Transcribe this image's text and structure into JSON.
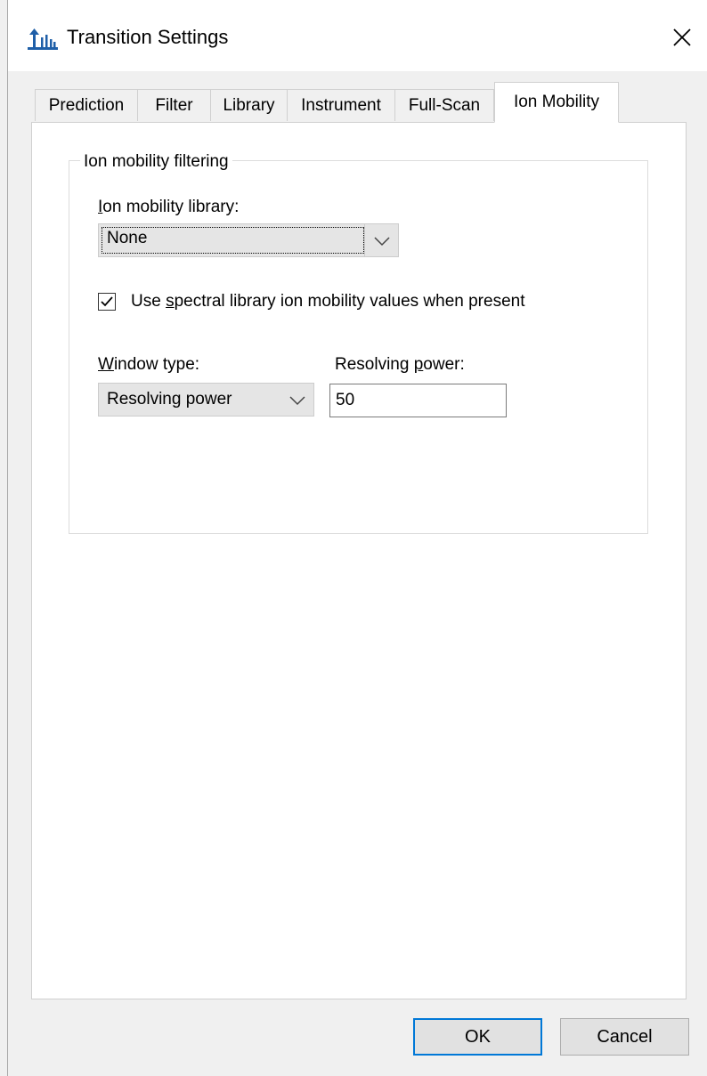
{
  "window": {
    "title": "Transition Settings",
    "close_symbol": "✕"
  },
  "tabs": [
    {
      "label": "Prediction",
      "active": false
    },
    {
      "label": "Filter",
      "active": false
    },
    {
      "label": "Library",
      "active": false
    },
    {
      "label": "Instrument",
      "active": false
    },
    {
      "label": "Full-Scan",
      "active": false
    },
    {
      "label": "Ion Mobility",
      "active": true
    }
  ],
  "group": {
    "legend": "Ion mobility filtering",
    "library_label_mnemonic": "I",
    "library_label_rest": "on mobility library:",
    "library_value": "None",
    "use_spectral_checked": true,
    "use_spectral_before": "Use ",
    "use_spectral_mnemonic": "s",
    "use_spectral_after": "pectral library ion mobility values when present",
    "window_type_mnemonic": "W",
    "window_type_rest": "indow type:",
    "window_type_value": "Resolving power",
    "resolving_power_before": "Resolving ",
    "resolving_power_mnemonic": "p",
    "resolving_power_after": "ower:",
    "resolving_power_value": "50"
  },
  "buttons": {
    "ok": "OK",
    "cancel": "Cancel"
  },
  "icons": {
    "app": "transition-settings-app-icon",
    "close": "close-icon",
    "dropdown": "chevron-down-icon",
    "check": "checkmark-icon"
  },
  "colors": {
    "accent": "#0078d7",
    "app_icon": "#1f5fa8"
  }
}
